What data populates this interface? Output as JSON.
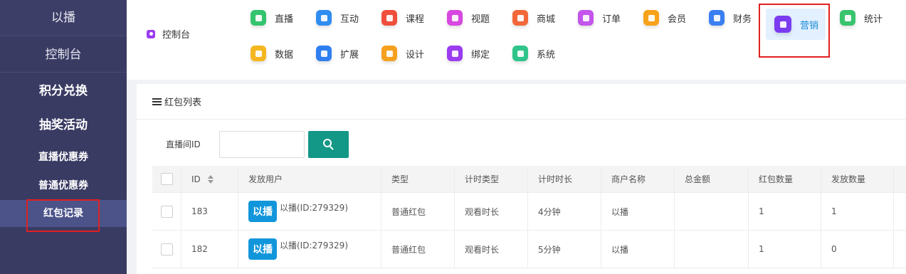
{
  "sidebar": {
    "logo": "以播",
    "console": "控制台",
    "items": [
      {
        "label": "积分兑换"
      },
      {
        "label": "抽奖活动"
      },
      {
        "label": "直播优惠券"
      },
      {
        "label": "普通优惠券"
      },
      {
        "label": "红包记录"
      }
    ]
  },
  "topnav": {
    "console_label": "控制台",
    "row1": [
      {
        "label": "直播",
        "icon": "live-icon",
        "color": "#33c46f"
      },
      {
        "label": "互动",
        "icon": "chat-icon",
        "color": "#2f8df0"
      },
      {
        "label": "课程",
        "icon": "course-icon",
        "color": "#f04e3c"
      },
      {
        "label": "视题",
        "icon": "video-icon",
        "color": "#d748e0"
      },
      {
        "label": "商城",
        "icon": "shop-icon",
        "color": "#f2673a"
      },
      {
        "label": "订单",
        "icon": "order-icon",
        "color": "#c454ec"
      },
      {
        "label": "会员",
        "icon": "member-icon",
        "color": "#f7a21b"
      },
      {
        "label": "财务",
        "icon": "finance-icon",
        "color": "#3a7ff2"
      },
      {
        "label": "统计",
        "icon": "stats-icon",
        "color": "#39c46e"
      }
    ],
    "active": {
      "label": "营销",
      "icon": "marketing-icon",
      "color": "#7b3cf0"
    },
    "row2": [
      {
        "label": "数据",
        "icon": "data-icon",
        "color": "#f5b71f"
      },
      {
        "label": "扩展",
        "icon": "extend-icon",
        "color": "#2f7ff0"
      },
      {
        "label": "设计",
        "icon": "design-icon",
        "color": "#f5a11f"
      },
      {
        "label": "绑定",
        "icon": "bind-icon",
        "color": "#9b3cf0"
      },
      {
        "label": "系统",
        "icon": "system-icon",
        "color": "#2fc48a"
      }
    ]
  },
  "card": {
    "title": "红包列表",
    "search": {
      "label": "直播间ID",
      "value": "",
      "placeholder": ""
    },
    "table": {
      "headers": [
        "ID",
        "发放用户",
        "类型",
        "计时类型",
        "计时时长",
        "商户名称",
        "总金额",
        "红包数量",
        "发放数量"
      ],
      "rows": [
        {
          "id": "183",
          "avatar": "以播",
          "user": "以播(ID:279329)",
          "type": "普通红包",
          "timer_type": "观看时长",
          "timer_length": "4分钟",
          "merchant": "以播",
          "total": "",
          "count": "1",
          "issued": "1"
        },
        {
          "id": "182",
          "avatar": "以播",
          "user": "以播(ID:279329)",
          "type": "普通红包",
          "timer_type": "观看时长",
          "timer_length": "5分钟",
          "merchant": "以播",
          "total": "",
          "count": "1",
          "issued": "0"
        }
      ]
    }
  },
  "colors": {
    "sidebar_bg": "#3a3b63",
    "sidebar_active": "#4b5389",
    "accent_teal": "#139787",
    "highlight_red": "#e02020",
    "active_nav_bg": "#e3f0ff",
    "active_nav_text": "#1a8bd8"
  }
}
